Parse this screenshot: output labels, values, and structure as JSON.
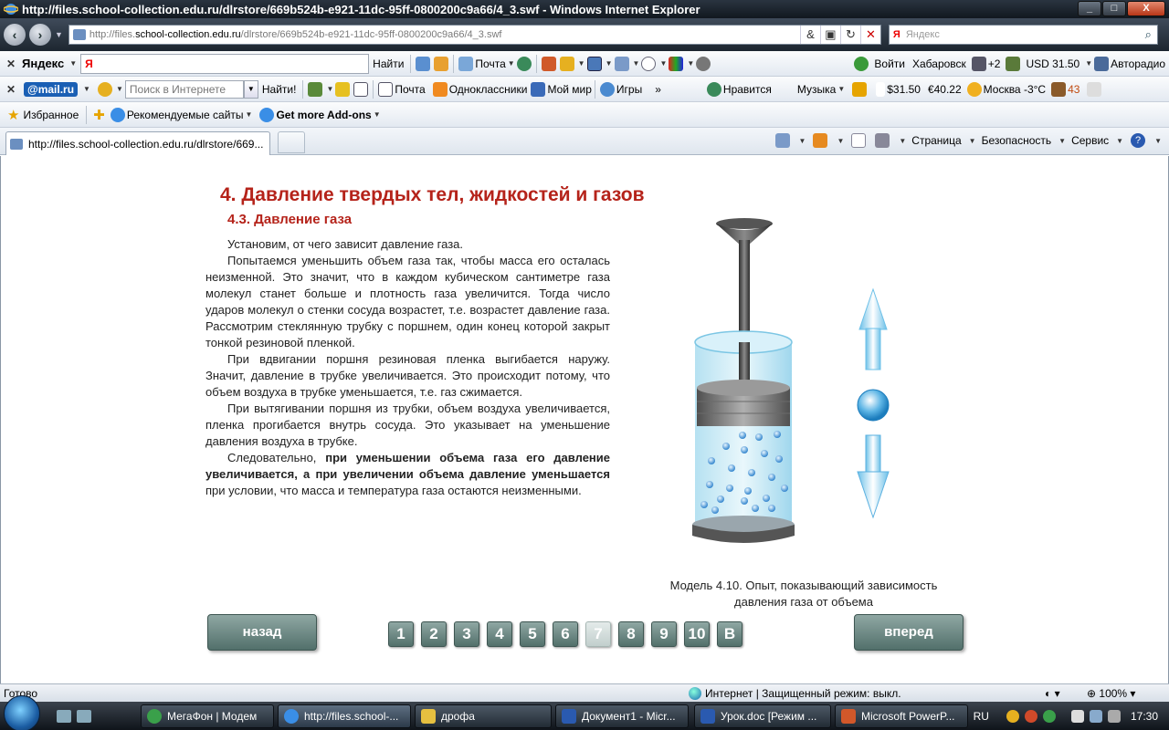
{
  "window": {
    "title": "http://files.school-collection.edu.ru/dlrstore/669b524b-e921-11dc-95ff-0800200c9a66/4_3.swf - Windows Internet Explorer",
    "min": "_",
    "max": "□",
    "close": "X"
  },
  "address": {
    "prefix": "http://files.",
    "host": "school-collection.edu.ru",
    "path": "/dlrstore/669b524b-e921-11dc-95ff-0800200c9a66/4_3.swf"
  },
  "search": {
    "placeholder": "Яндекс",
    "engine_badge": "Я"
  },
  "yandex_bar": {
    "logo": "Яндекс",
    "input_badge": "Я",
    "find": "Найти",
    "mail": "Почта",
    "login": "Войти",
    "city": "Хабаровск",
    "weather": "+2",
    "usd": "USD 31.50",
    "radio": "Авторадио"
  },
  "mail_bar": {
    "logo": "@mail.ru",
    "search_placeholder": "Поиск в Интернете",
    "find": "Найти!",
    "mail": "Почта",
    "odnoklassniki": "Одноклассники",
    "mymir": "Мой мир",
    "games": "Игры",
    "likes": "Нравится",
    "music": "Музыка",
    "usd": "$31.50",
    "eur": "€40.22",
    "weather": "Москва -3°C",
    "count": "43"
  },
  "favorites_bar": {
    "favorites": "Избранное",
    "recommended": "Рекомендуемые сайты",
    "addons": "Get more Add-ons"
  },
  "tab": {
    "label": "http://files.school-collection.edu.ru/dlrstore/669..."
  },
  "command_bar": {
    "page": "Страница",
    "safety": "Безопасность",
    "tools": "Сервис"
  },
  "content": {
    "title": "4. Давление твердых тел, жидкостей и газов",
    "subtitle": "4.3. Давление газа",
    "p1": "Установим, от чего зависит давление газа.",
    "p2": "Попытаемся уменьшить объем газа так, чтобы масса его осталась неизменной. Это значит, что в каждом кубическом сантиметре газа молекул станет больше и плотность газа увеличится. Тогда число ударов молекул о стенки сосуда возрастет, т.е. возрастет давление газа. Рассмотрим стеклянную трубку с поршнем, один конец которой закрыт тонкой резиновой пленкой.",
    "p3": "При вдвигании поршня резиновая пленка выгибается  наружу. Значит, давление в трубке увеличивается. Это происходит потому, что объем воздуха в трубке уменьшается, т.е. газ сжимается.",
    "p4": "При вытягивании поршня из трубки, объем воздуха увеличивается, пленка прогибается внутрь сосуда. Это указывает на уменьшение давления воздуха в трубке.",
    "p5_start": "Следовательно, ",
    "p5_bold": "при уменьшении объема газа его давление увеличивается, а при увеличении объема давление уменьшается",
    "p5_end": " при условии, что масса и температура газа остаются неизменными.",
    "caption_line1": "Модель 4.10. Опыт, показывающий зависимость",
    "caption_line2": "давления газа от объема",
    "back": "назад",
    "forward": "вперед",
    "pages": [
      "1",
      "2",
      "3",
      "4",
      "5",
      "6",
      "7",
      "8",
      "9",
      "10",
      "В"
    ],
    "current_page": "7"
  },
  "status": {
    "left": "Готово",
    "zone": "Интернет | Защищенный режим: выкл.",
    "zoom": "100%"
  },
  "taskbar": {
    "items": [
      "МегаФон | Модем",
      "http://files.school-...",
      "дрофа",
      "Документ1 - Micr...",
      "Урок.doc [Режим ...",
      "Microsoft PowerP..."
    ],
    "lang": "RU",
    "time": "17:30"
  },
  "colors": {
    "heading": "#b5231a",
    "button": "#5f7c77"
  }
}
